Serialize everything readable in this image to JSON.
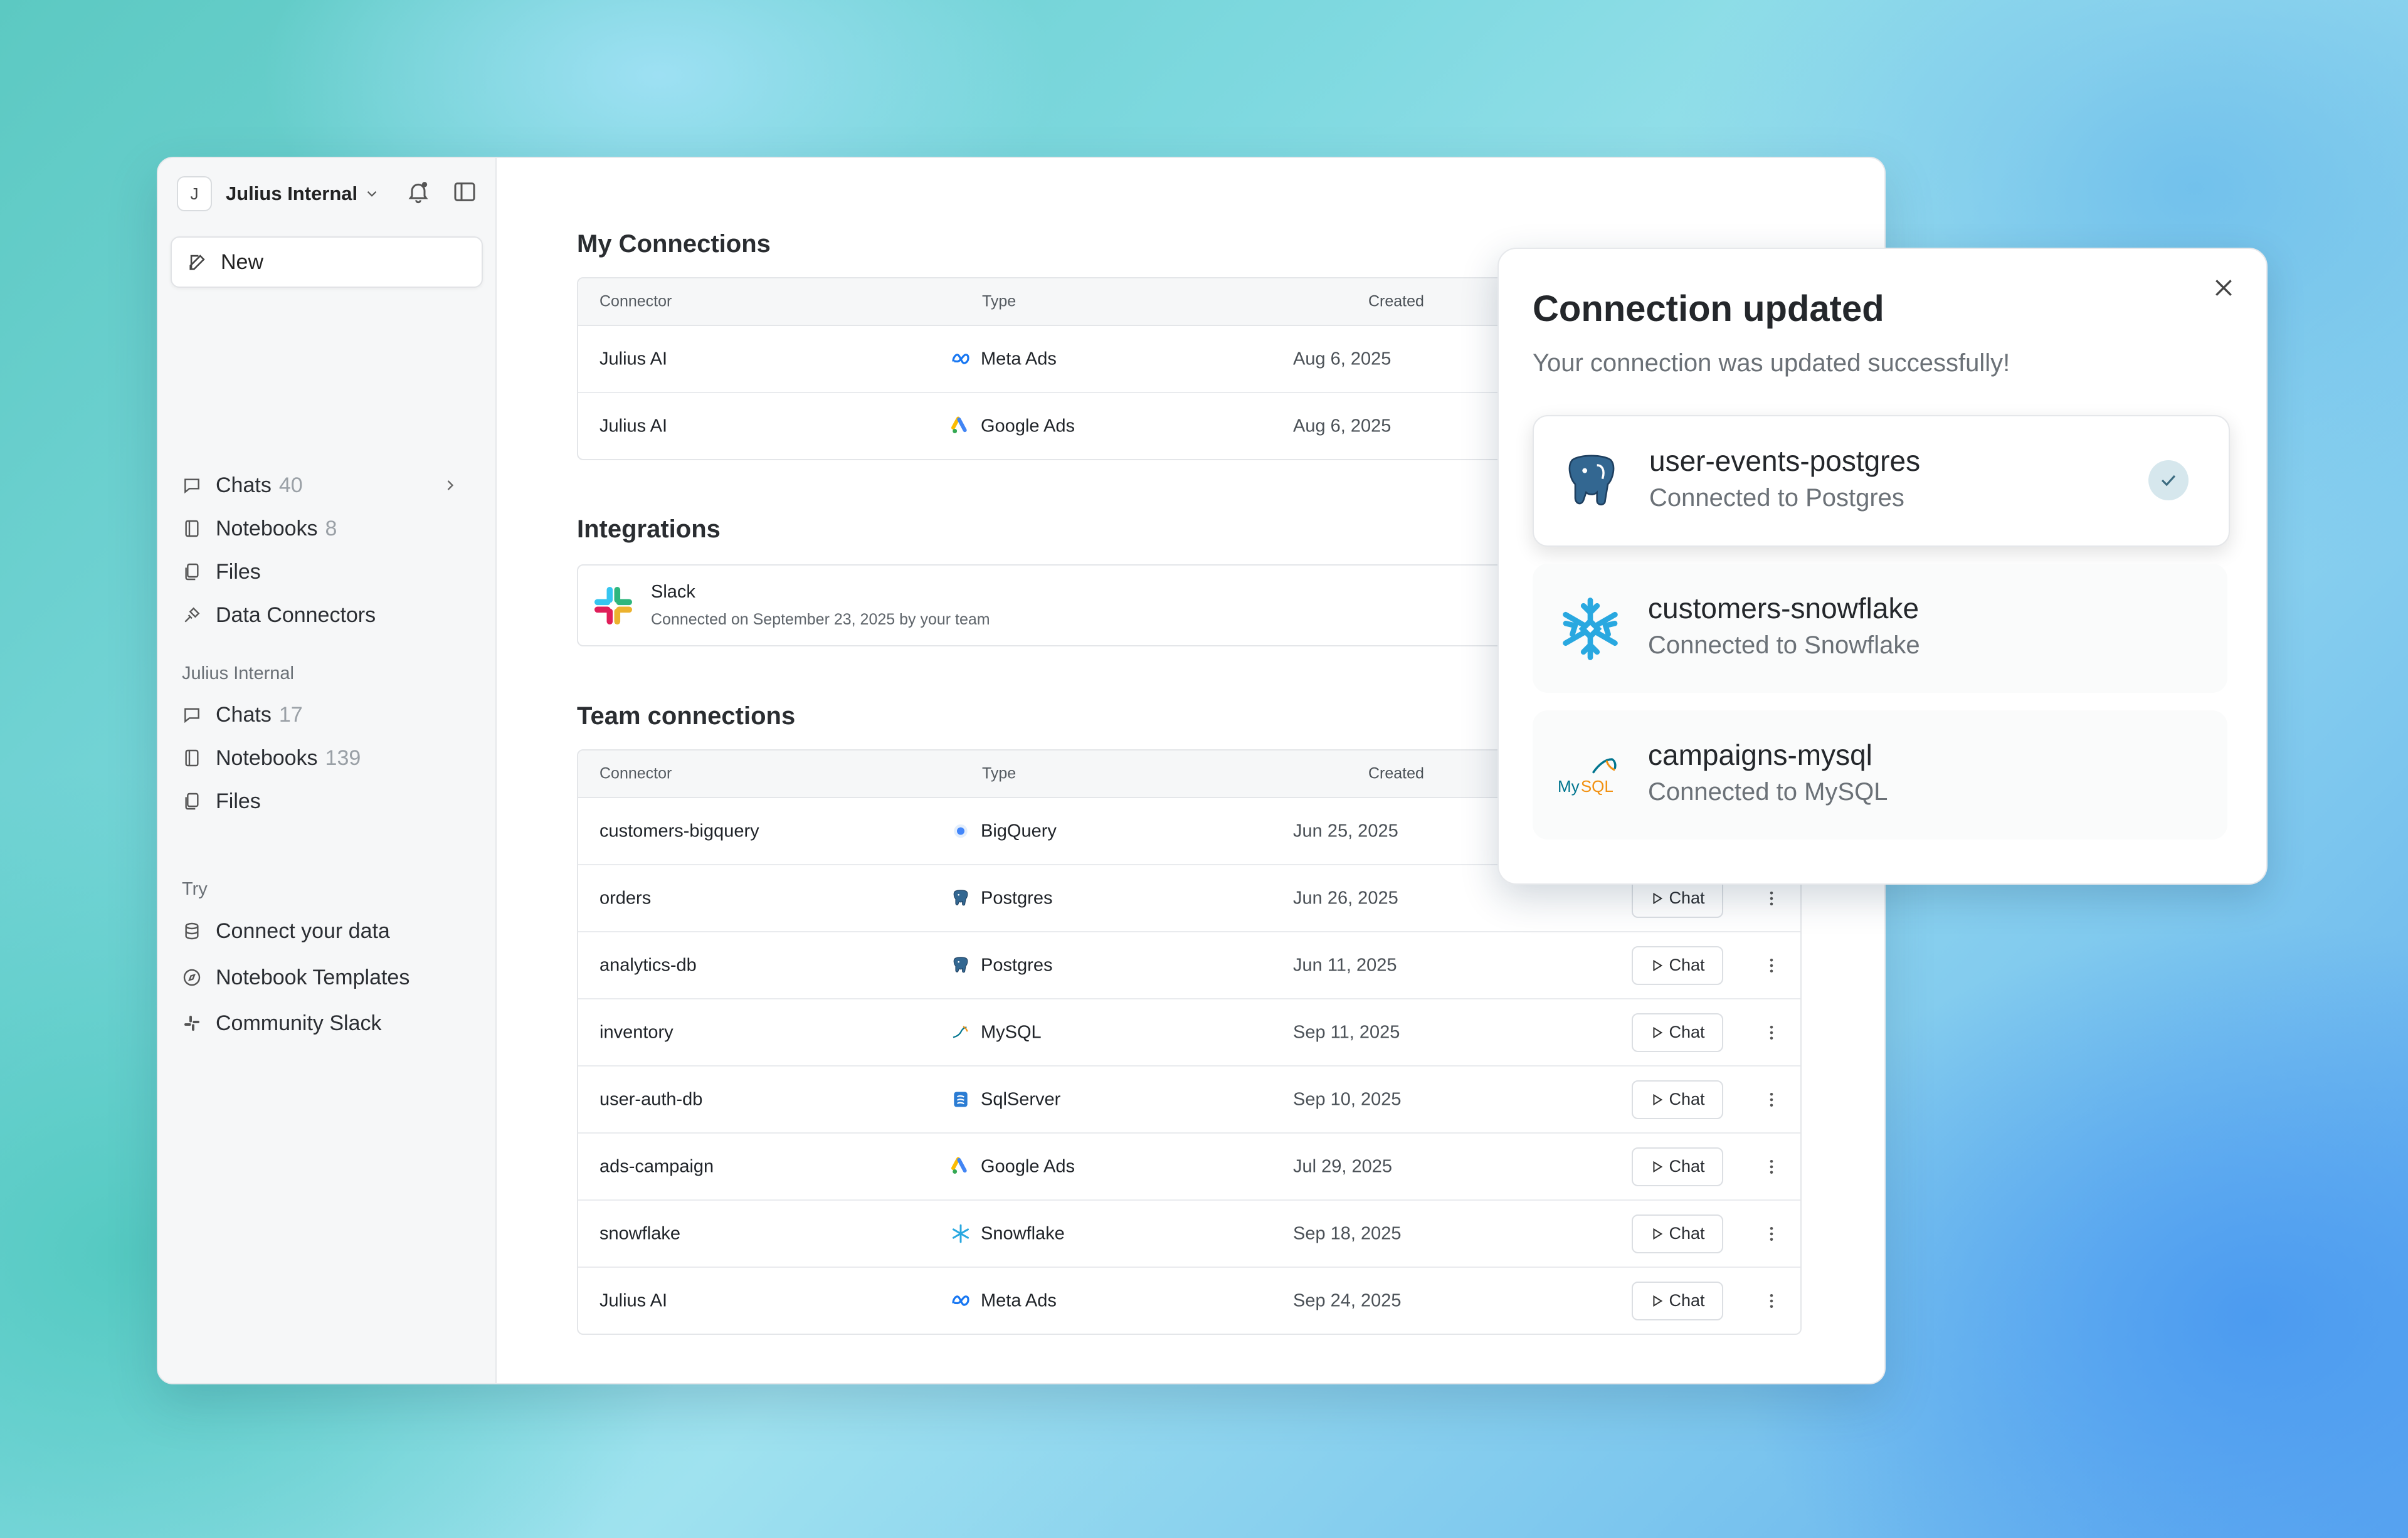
{
  "workspace": {
    "initial": "J",
    "name": "Julius Internal"
  },
  "sidebar": {
    "new_label": "New",
    "personal": [
      {
        "label": "Chats",
        "count": "40"
      },
      {
        "label": "Notebooks",
        "count": "8"
      },
      {
        "label": "Files",
        "count": ""
      },
      {
        "label": "Data Connectors",
        "count": ""
      }
    ],
    "team_label": "Julius Internal",
    "team": [
      {
        "label": "Chats",
        "count": "17"
      },
      {
        "label": "Notebooks",
        "count": "139"
      },
      {
        "label": "Files",
        "count": ""
      }
    ],
    "try_label": "Try",
    "try": [
      {
        "label": "Connect your data"
      },
      {
        "label": "Notebook Templates"
      },
      {
        "label": "Community Slack"
      }
    ]
  },
  "main": {
    "my_connections_title": "My Connections",
    "columns": {
      "connector": "Connector",
      "type": "Type",
      "created": "Created"
    },
    "my_connections": [
      {
        "name": "Julius AI",
        "type": "Meta Ads",
        "icon": "meta-icon",
        "created": "Aug 6, 2025"
      },
      {
        "name": "Julius AI",
        "type": "Google Ads",
        "icon": "google-ads-icon",
        "created": "Aug 6, 2025"
      }
    ],
    "integrations_title": "Integrations",
    "integration": {
      "name": "Slack",
      "detail": "Connected on September 23, 2025 by your team"
    },
    "team_connections_title": "Team connections",
    "chat_label": "Chat",
    "team_connections": [
      {
        "name": "customers-bigquery",
        "type": "BigQuery",
        "icon": "bigquery-icon",
        "created": "Jun 25, 2025"
      },
      {
        "name": "orders",
        "type": "Postgres",
        "icon": "postgres-icon",
        "created": "Jun 26, 2025"
      },
      {
        "name": "analytics-db",
        "type": "Postgres",
        "icon": "postgres-icon",
        "created": "Jun 11, 2025"
      },
      {
        "name": "inventory",
        "type": "MySQL",
        "icon": "mysql-icon",
        "created": "Sep 11, 2025"
      },
      {
        "name": "user-auth-db",
        "type": "SqlServer",
        "icon": "sqlserver-icon",
        "created": "Sep 10, 2025"
      },
      {
        "name": "ads-campaign",
        "type": "Google Ads",
        "icon": "google-ads-icon",
        "created": "Jul 29, 2025"
      },
      {
        "name": "snowflake",
        "type": "Snowflake",
        "icon": "snowflake-icon",
        "created": "Sep 18, 2025"
      },
      {
        "name": "Julius AI",
        "type": "Meta Ads",
        "icon": "meta-icon",
        "created": "Sep 24, 2025"
      }
    ]
  },
  "modal": {
    "title": "Connection updated",
    "subtitle": "Your connection was updated successfully!",
    "connections": [
      {
        "name": "user-events-postgres",
        "detail": "Connected to Postgres",
        "icon": "postgres-icon",
        "selected": true
      },
      {
        "name": "customers-snowflake",
        "detail": "Connected to Snowflake",
        "icon": "snowflake-icon",
        "selected": false
      },
      {
        "name": "campaigns-mysql",
        "detail": "Connected to MySQL",
        "icon": "mysql-icon",
        "selected": false
      }
    ]
  },
  "colors": {
    "accent_check_bg": "#d6e7ed",
    "snowflake": "#29a8e0",
    "postgres": "#336791"
  }
}
